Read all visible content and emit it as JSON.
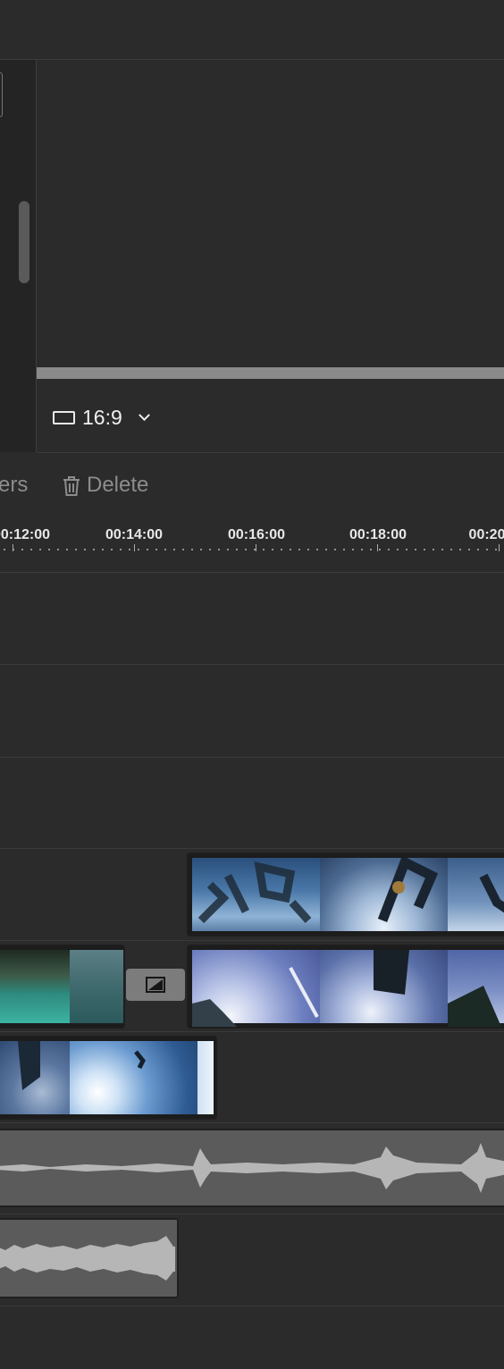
{
  "preview": {
    "aspect_ratio": "16:9"
  },
  "toolbar": {
    "markers_label_fragment": "ers",
    "delete_label": "Delete"
  },
  "ruler": {
    "ticks": [
      "00:12:00",
      "00:14:00",
      "00:16:00",
      "00:18:00",
      "00:20"
    ]
  },
  "icons": {
    "aspect": "rectangle-icon",
    "chevron": "chevron-down-icon",
    "delete": "trash-icon",
    "transition": "transition-icon"
  },
  "colors": {
    "background": "#2b2b2b",
    "panel": "#242424",
    "clip_border": "#1e1e1e",
    "audio_fill": "#5b5b5b",
    "waveform": "#b5b5b5"
  }
}
